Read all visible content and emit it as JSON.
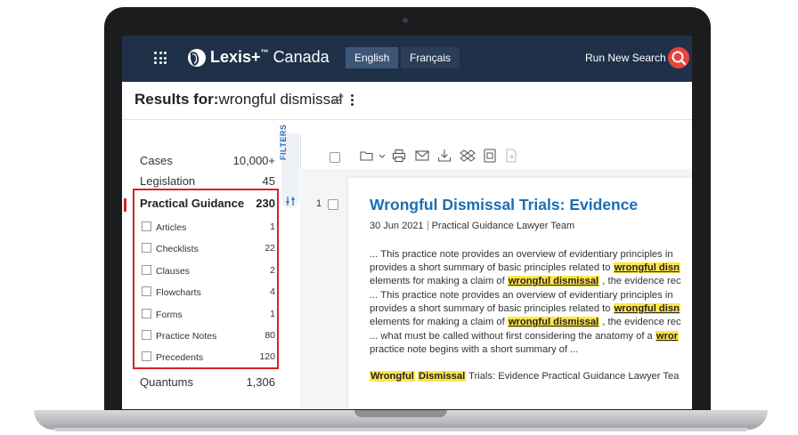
{
  "header": {
    "brand": "Lexis+",
    "brand_tm": "™",
    "brand_suffix": "Canada",
    "lang_english": "English",
    "lang_french": "Français",
    "run_new_search": "Run New Search"
  },
  "results": {
    "label": "Results for:",
    "query": "wrongful dismissal"
  },
  "filters_tab": "FILTERS",
  "facets": [
    {
      "label": "Cases",
      "count": "10,000+"
    },
    {
      "label": "Legislation",
      "count": "45"
    },
    {
      "label": "Practical Guidance",
      "count": "230"
    },
    {
      "label": "Quantums",
      "count": "1,306"
    }
  ],
  "subfacets": [
    {
      "label": "Articles",
      "count": "1"
    },
    {
      "label": "Checklists",
      "count": "22"
    },
    {
      "label": "Clauses",
      "count": "2"
    },
    {
      "label": "Flowcharts",
      "count": "4"
    },
    {
      "label": "Forms",
      "count": "1"
    },
    {
      "label": "Practice Notes",
      "count": "80"
    },
    {
      "label": "Precedents",
      "count": "120"
    }
  ],
  "result": {
    "number": "1",
    "title": "Wrongful Dismissal Trials: Evidence",
    "date": "30 Jun 2021",
    "source": "Practical Guidance Lawyer Team",
    "l1": "... This practice note provides an overview of evidentiary principles in",
    "l2a": "provides a short summary of basic principles related to ",
    "l2m": "wrongful disn",
    "l3a": "elements for making a claim of ",
    "l3m": "wrongful dismissal",
    "l3b": " , the evidence rec",
    "l4": "... This practice note provides an overview of evidentiary principles in",
    "l5a": "provides a short summary of basic principles related to ",
    "l5m": "wrongful disn",
    "l6a": "elements for making a claim of ",
    "l6m": "wrongful dismissal",
    "l6b": " , the evidence rec",
    "l7a": "... what must be called without first considering the anatomy of a ",
    "l7m": "wror",
    "l8": "practice note begins with a short summary of ...",
    "l9m1": "Wrongful",
    "l9m2": "Dismissal",
    "l9b": " Trials: Evidence Practical Guidance Lawyer Tea"
  }
}
